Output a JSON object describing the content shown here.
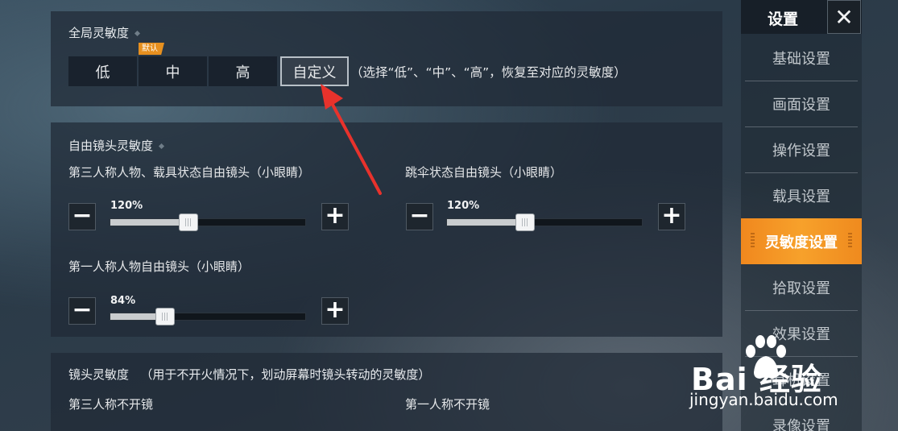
{
  "global_sensitivity": {
    "title": "全局灵敏度",
    "default_tag": "默认",
    "presets": [
      "低",
      "中",
      "高",
      "自定义"
    ],
    "selected": "自定义",
    "hint": "（选择“低”、“中”、“高”，恢复至对应的灵敏度）"
  },
  "free_camera": {
    "title": "自由镜头灵敏度",
    "sliders": [
      {
        "label": "第三人称人物、载具状态自由镜头（小眼睛）",
        "value": "120%",
        "level": 0.4
      },
      {
        "label": "跳伞状态自由镜头（小眼睛）",
        "value": "120%",
        "level": 0.4
      },
      {
        "label": "第一人称人物自由镜头（小眼睛）",
        "value": "84%",
        "level": 0.28
      }
    ],
    "minus_symbol": "−",
    "plus_symbol": "+"
  },
  "camera_sensitivity": {
    "title": "镜头灵敏度",
    "note": "（用于不开火情况下，划动屏幕时镜头转动的灵敏度）",
    "col_left": "第三人称不开镜",
    "col_right": "第一人称不开镜"
  },
  "sidebar": {
    "title": "设置",
    "close_symbol": "✕",
    "items": [
      "基础设置",
      "画面设置",
      "操作设置",
      "载具设置",
      "灵敏度设置",
      "拾取设置",
      "效果设置",
      "耳机设置",
      "录像设置"
    ],
    "active": "灵敏度设置"
  },
  "watermark": {
    "brand": "Bai 经验",
    "url": "jingyan.baidu.com"
  },
  "colors": {
    "accent": "#f39524",
    "annotation_arrow": "#e8322c",
    "default_tag": "#e7901f"
  },
  "icons": {
    "close": "close-icon",
    "minus": "minus-icon",
    "plus": "plus-icon",
    "watermark": "paw-icon",
    "annotation": "arrow-icon"
  }
}
